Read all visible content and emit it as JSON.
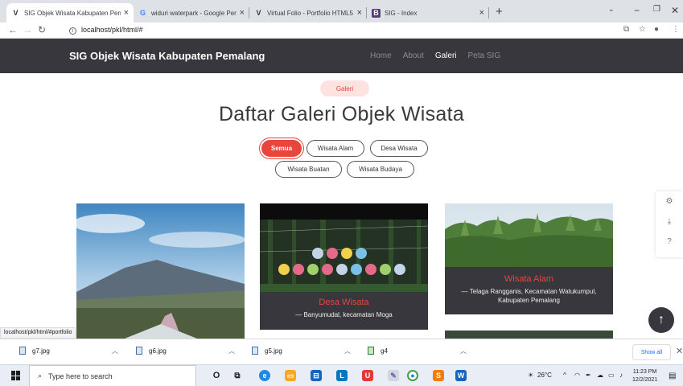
{
  "browser": {
    "tabs": [
      {
        "title": "SIG Objek Wisata Kabupaten Pem",
        "icon": "site-v-icon",
        "active": true
      },
      {
        "title": "widuri waterpark - Google Penel",
        "icon": "google-icon",
        "active": false
      },
      {
        "title": "Virtual Folio - Portfolio HTML5 Te",
        "icon": "site-v-icon",
        "active": false
      },
      {
        "title": "SIG - Index",
        "icon": "bootstrap-b-icon",
        "active": false
      }
    ],
    "url": "localhost/pkl/html/#",
    "status_link": "localhost/pkl/html/#portfolio"
  },
  "site": {
    "brand": "SIG Objek Wisata Kabupaten Pemalang",
    "nav": [
      "Home",
      "About",
      "Galeri",
      "Peta SIG"
    ],
    "nav_active": "Galeri"
  },
  "section": {
    "pill": "Galeri",
    "title": "Daftar Galeri Objek Wisata",
    "filters": [
      "Semua",
      "Wisata Alam",
      "Desa Wisata",
      "Wisata Buatan",
      "Wisata Budaya"
    ],
    "filter_active": "Semua"
  },
  "cards": [
    {
      "title": "",
      "desc": ""
    },
    {
      "title": "Desa Wisata",
      "desc": "— Banyumudal, kecamatan Moga"
    },
    {
      "title": "Wisata Alam",
      "desc": "— Telaga Rangganis, Kecamatan Watukumpul, Kabupaten Pemalang"
    }
  ],
  "downloads": [
    {
      "name": "g7.jpg"
    },
    {
      "name": "g6.jpg"
    },
    {
      "name": "g5.jpg"
    },
    {
      "name": "g4"
    }
  ],
  "downloads_show_all": "Show all",
  "taskbar": {
    "search_placeholder": "Type here to search",
    "temperature": "26°C",
    "time": "11:23 PM",
    "date": "12/2/2021"
  },
  "colors": {
    "accent": "#e8453c",
    "navbar": "#37373d",
    "pill_bg": "#fde2e0"
  }
}
